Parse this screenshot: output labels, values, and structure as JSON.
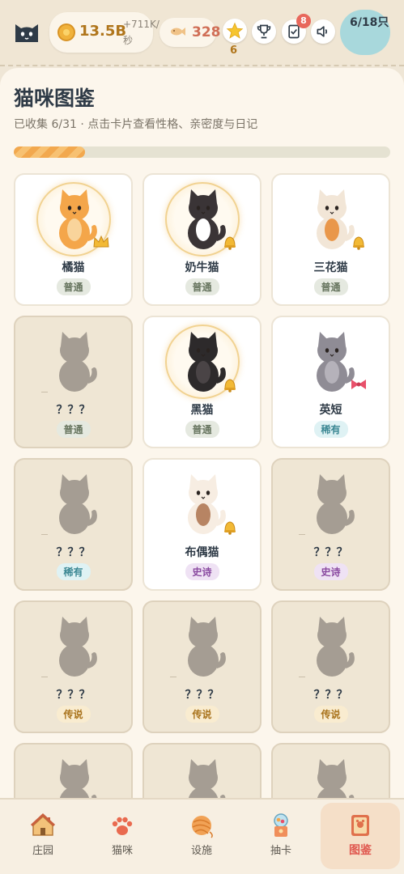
{
  "header": {
    "coins": "13.5B",
    "coin_rate": "+711K/秒",
    "fish": "328",
    "star_count": "6",
    "tasks_badge": "8",
    "cat_count": "6/18只"
  },
  "page": {
    "title": "猫咪图鉴",
    "subtitle": "已收集 6/31 · 点击卡片查看性格、亲密度与日记",
    "progress": 0.19
  },
  "cards": [
    {
      "name": "橘猫",
      "rarity": "普通",
      "rarity_key": "common",
      "status": "collected",
      "fur": "#f4a64a",
      "accent": "#f9d49b",
      "accessory": "crown-icon"
    },
    {
      "name": "奶牛猫",
      "rarity": "普通",
      "rarity_key": "common",
      "status": "collected",
      "fur": "#3a3436",
      "accent": "#ffffff",
      "accessory": "bell-icon"
    },
    {
      "name": "三花猫",
      "rarity": "普通",
      "rarity_key": "common",
      "status": "collected",
      "fur": "#f2e6d7",
      "accent": "#e9974a",
      "accessory": "bell-icon"
    },
    {
      "name": "？？？",
      "rarity": "普通",
      "rarity_key": "common",
      "status": "locked"
    },
    {
      "name": "黑猫",
      "rarity": "普通",
      "rarity_key": "common",
      "status": "collected",
      "fur": "#2d2a2b",
      "accent": "#4a4446",
      "accessory": "bell-icon"
    },
    {
      "name": "英短",
      "rarity": "稀有",
      "rarity_key": "rare",
      "status": "collected",
      "fur": "#8f8c95",
      "accent": "#b5b2ba",
      "accessory": "bow-icon"
    },
    {
      "name": "？？？",
      "rarity": "稀有",
      "rarity_key": "rare",
      "status": "locked"
    },
    {
      "name": "布偶猫",
      "rarity": "史诗",
      "rarity_key": "epic",
      "status": "collected",
      "fur": "#f7ede2",
      "accent": "#b78463",
      "accessory": "bell-icon"
    },
    {
      "name": "？？？",
      "rarity": "史诗",
      "rarity_key": "epic",
      "status": "locked"
    },
    {
      "name": "？？？",
      "rarity": "传说",
      "rarity_key": "legend",
      "status": "locked"
    },
    {
      "name": "？？？",
      "rarity": "传说",
      "rarity_key": "legend",
      "status": "locked"
    },
    {
      "name": "？？？",
      "rarity": "传说",
      "rarity_key": "legend",
      "status": "locked"
    },
    {
      "name": "",
      "rarity": "",
      "rarity_key": "",
      "status": "locked"
    },
    {
      "name": "",
      "rarity": "",
      "rarity_key": "",
      "status": "locked"
    },
    {
      "name": "",
      "rarity": "",
      "rarity_key": "",
      "status": "locked"
    }
  ],
  "nav": [
    {
      "label": "庄园",
      "icon": "house-icon"
    },
    {
      "label": "猫咪",
      "icon": "paw-icon"
    },
    {
      "label": "设施",
      "icon": "yarn-ball-icon"
    },
    {
      "label": "抽卡",
      "icon": "gacha-machine-icon"
    },
    {
      "label": "图鉴",
      "icon": "book-icon",
      "active": true
    }
  ],
  "colors": {
    "accent": "#e0584f",
    "silhouette": "#a59d93",
    "coin": "#b0761c"
  }
}
